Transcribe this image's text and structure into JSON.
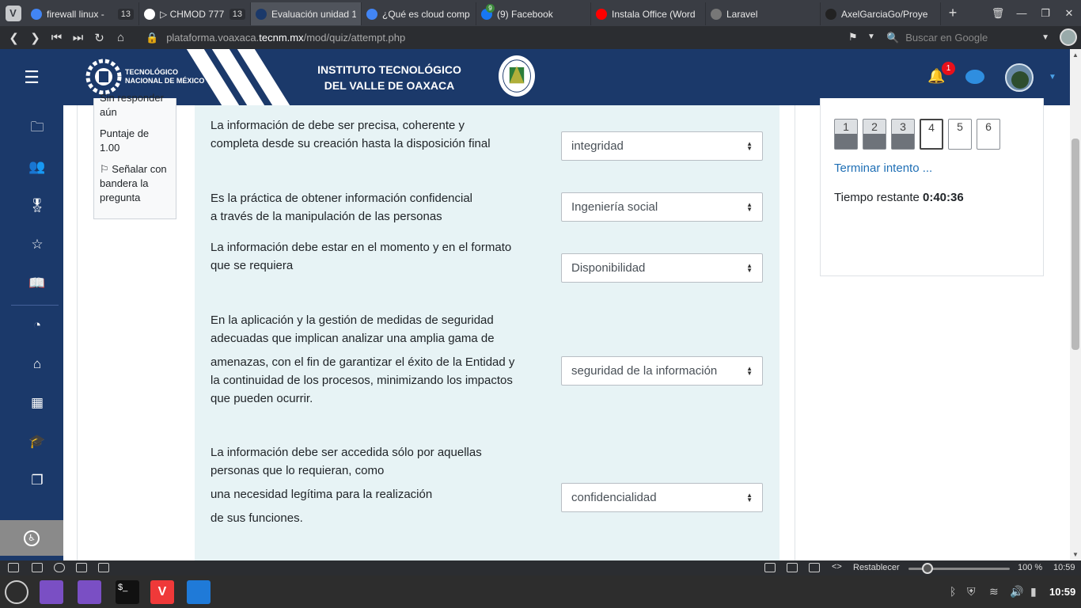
{
  "browser": {
    "tabs": [
      {
        "label": "firewall linux - ",
        "count": "13",
        "favicon": "google-icon",
        "color": "#4285f4",
        "active": false
      },
      {
        "label": "▷ CHMOD 777,",
        "count": "13",
        "favicon": "github-icon",
        "color": "#ffffff",
        "active": false
      },
      {
        "label": "Evaluación unidad 1",
        "count": "",
        "favicon": "moodle-icon",
        "color": "#1b396a",
        "active": true
      },
      {
        "label": "¿Qué es cloud comp",
        "count": "",
        "favicon": "docs-icon",
        "color": "#4285f4",
        "active": false
      },
      {
        "label": "(9) Facebook",
        "count": "",
        "favicon": "facebook-icon",
        "color": "#1877f2",
        "active": false,
        "badge": "9"
      },
      {
        "label": "Instala Office (Word",
        "count": "",
        "favicon": "youtube-icon",
        "color": "#ff0000",
        "active": false
      },
      {
        "label": "Laravel",
        "count": "",
        "favicon": "globe-icon",
        "color": "#777777",
        "active": false
      },
      {
        "label": "AxelGarciaGo/Proye",
        "count": "",
        "favicon": "github-icon",
        "color": "#222222",
        "active": false
      }
    ],
    "url_prefix": "plataforma.voaxaca.",
    "url_domain": "tecnm.mx",
    "url_path": "/mod/quiz/attempt.php",
    "search_placeholder": "Buscar en Google"
  },
  "header": {
    "tnm_line1": "TECNOLÓGICO",
    "tnm_line2": "NACIONAL DE MÉXICO",
    "institute_line1": "INSTITUTO TECNOLÓGICO",
    "institute_line2": "DEL VALLE DE OAXACA",
    "notification_count": "1"
  },
  "question_info": {
    "status": "Sin responder aún",
    "score_label": "Puntaje de",
    "score_value": "1.00",
    "flag_label": "Señalar con bandera la pregunta"
  },
  "matching": [
    {
      "prompt_lines": [
        "La información de debe ser precisa, coherente y",
        "completa desde su creación hasta la disposición final"
      ],
      "answer": "integridad"
    },
    {
      "prompt_lines": [
        "Es la práctica de obtener información confidencial",
        "a través de la manipulación de las personas"
      ],
      "answer": "Ingeniería social"
    },
    {
      "prompt_lines": [
        "La información debe estar en el momento y en el formato",
        "que se requiera"
      ],
      "answer": "Disponibilidad"
    },
    {
      "prompt_lines": [
        "En la aplicación y la gestión de medidas de seguridad",
        "adecuadas que implican analizar una amplia gama de",
        "amenazas, con el fin de garantizar el éxito de la Entidad y",
        "la continuidad de los procesos, minimizando los impactos",
        "que pueden ocurrir."
      ],
      "answer": "seguridad de la información"
    },
    {
      "prompt_lines": [
        "La información debe ser accedida sólo por aquellas",
        "personas que lo requieran, como",
        "una necesidad legítima para la realización",
        "de sus funciones."
      ],
      "answer": "confidencialidad"
    }
  ],
  "quiz_nav": {
    "questions": [
      {
        "number": "1",
        "state": "answered"
      },
      {
        "number": "2",
        "state": "answered"
      },
      {
        "number": "3",
        "state": "answered"
      },
      {
        "number": "4",
        "state": "current"
      },
      {
        "number": "5",
        "state": "unanswered"
      },
      {
        "number": "6",
        "state": "unanswered"
      }
    ],
    "finish_label": "Terminar intento ...",
    "time_label": "Tiempo restante",
    "time_value": "0:40:36"
  },
  "statusbar": {
    "reset_label": "Restablecer",
    "zoom": "100 %",
    "zoom_fraction": 0.19,
    "time": "10:59"
  },
  "taskbar": {
    "clock": "10:59"
  },
  "colors": {
    "brand_navy": "#1b396a",
    "content_bg": "#e7f3f5",
    "link_blue": "#1f6fb5",
    "badge_red": "#e8101b"
  }
}
